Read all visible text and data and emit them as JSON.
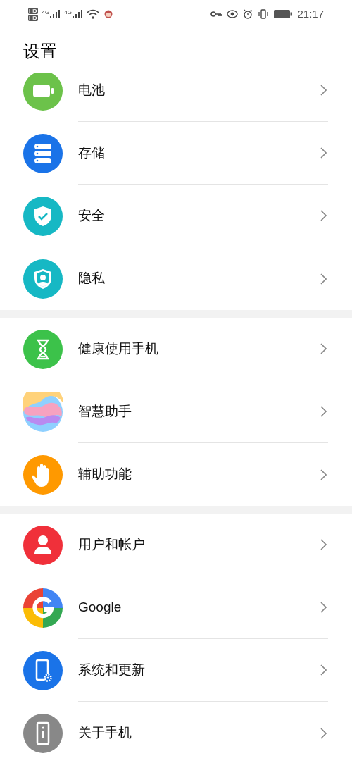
{
  "status_bar": {
    "sim_labels": [
      "HD",
      "HD"
    ],
    "network_labels": [
      "4G",
      "4G"
    ],
    "time": "21:17"
  },
  "title": "设置",
  "sections": [
    {
      "items": [
        {
          "label": "电池",
          "kind": "battery"
        },
        {
          "label": "存储",
          "kind": "storage"
        },
        {
          "label": "安全",
          "kind": "security"
        },
        {
          "label": "隐私",
          "kind": "privacy"
        }
      ]
    },
    {
      "items": [
        {
          "label": "健康使用手机",
          "kind": "hourglass"
        },
        {
          "label": "智慧助手",
          "kind": "assistant"
        },
        {
          "label": "辅助功能",
          "kind": "hand"
        }
      ]
    },
    {
      "items": [
        {
          "label": "用户和帐户",
          "kind": "user"
        },
        {
          "label": "Google",
          "kind": "google"
        },
        {
          "label": "系统和更新",
          "kind": "system"
        },
        {
          "label": "关于手机",
          "kind": "about"
        }
      ]
    }
  ]
}
